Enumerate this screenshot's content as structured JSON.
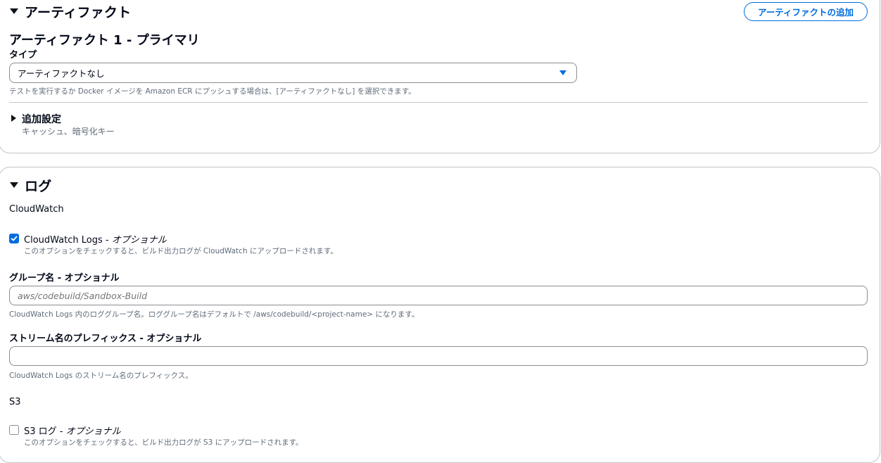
{
  "artifacts": {
    "section_title": "アーティファクト",
    "add_button_label": "アーティファクトの追加",
    "artifact_title": "アーティファクト 1 - プライマリ",
    "type_label": "タイプ",
    "type_selected": "アーティファクトなし",
    "type_description": "テストを実行するか Docker イメージを Amazon ECR にプッシュする場合は、[アーティファクトなし] を選択できます。",
    "additional_settings_label": "追加設定",
    "additional_settings_description": "キャッシュ、暗号化キー"
  },
  "logs": {
    "section_title": "ログ",
    "cloudwatch_heading": "CloudWatch",
    "cloudwatch_logs": {
      "label_main": "CloudWatch Logs - ",
      "label_optional": "オプショナル",
      "checked": true,
      "description": "このオプションをチェックすると、ビルド出力ログが CloudWatch にアップロードされます。"
    },
    "group_name": {
      "label": "グループ名 - オプショナル",
      "placeholder": "aws/codebuild/Sandbox-Build",
      "value": "",
      "description": "CloudWatch Logs 内のロググループ名。ロググループ名はデフォルトで /aws/codebuild/<project-name> になります。"
    },
    "stream_prefix": {
      "label": "ストリーム名のプレフィックス - オプショナル",
      "value": "",
      "description": "CloudWatch Logs のストリーム名のプレフィックス。"
    },
    "s3_heading": "S3",
    "s3_logs": {
      "label_main": "S3 ログ - ",
      "label_optional": "オプショナル",
      "checked": false,
      "description": "このオプションをチェックすると、ビルド出力ログが S3 にアップロードされます。"
    }
  },
  "colors": {
    "accent": "#006ce0",
    "border": "#c6c6cd",
    "text": "#000716",
    "secondary_text": "#5f6b7a"
  }
}
